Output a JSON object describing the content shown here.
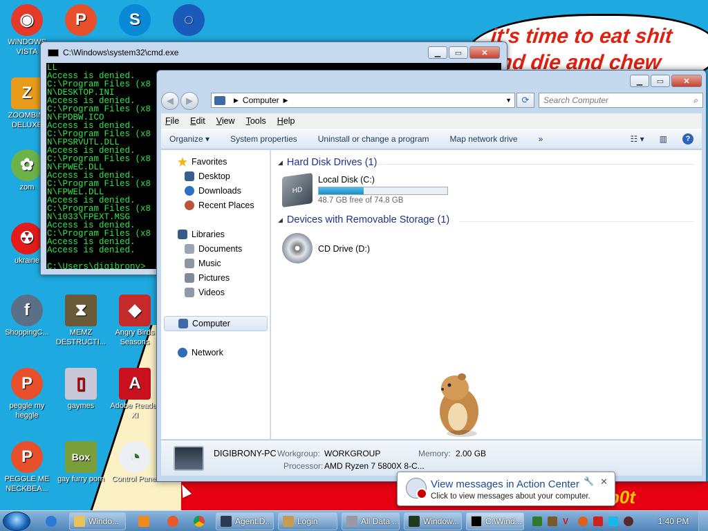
{
  "wallpaper": {
    "speech_text": "it's time to eat shit and die and chew",
    "red_text": "b0t"
  },
  "desktop_icons": [
    {
      "label": "WINDOWS VISTA",
      "color": "#e33a2a",
      "glyph": "◉"
    },
    {
      "label": "ZOOMBINI DELUXE",
      "color": "#e89a1a",
      "glyph": "Z"
    },
    {
      "label": "zom",
      "color": "#6cb24b",
      "glyph": "✿"
    },
    {
      "label": "ukraine",
      "color": "#e31b1b",
      "glyph": "☢"
    },
    {
      "label": "ShoppingC...",
      "color": "#5b6f86",
      "glyph": "f"
    },
    {
      "label": "peggle my heggle",
      "color": "#e7502a",
      "glyph": "P"
    },
    {
      "label": "PEGGLE ME NECKBEA...",
      "color": "#e7502a",
      "glyph": "P"
    },
    {
      "label": "",
      "color": "#e7502a",
      "glyph": "P"
    },
    {
      "label": "MEMZ DESTRUCTI...",
      "color": "#6a5a3a",
      "glyph": "⧗"
    },
    {
      "label": "gaymes",
      "color": "#c8c8d8",
      "glyph": "▯"
    },
    {
      "label": "gay furry porn",
      "color": "#7a9e3a",
      "glyph": "Box"
    },
    {
      "label": "",
      "color": "#0a8ad6",
      "glyph": "S"
    },
    {
      "label": "Angry Birds Seasons",
      "color": "#c42a2a",
      "glyph": "◆"
    },
    {
      "label": "Adobe Reader XI",
      "color": "#c8101e",
      "glyph": "A"
    },
    {
      "label": "Control Panel",
      "color": "#eceff3",
      "glyph": "◔"
    },
    {
      "label": "",
      "color": "#1a5ab8",
      "glyph": "◌"
    }
  ],
  "cmd": {
    "title": "C:\\Windows\\system32\\cmd.exe",
    "lines": [
      "LL",
      "Access is denied.",
      "C:\\Program Files (x8",
      "N\\DESKTOP.INI",
      "Access is denied.",
      "C:\\Program Files (x8",
      "N\\FPDBW.ICO",
      "Access is denied.",
      "C:\\Program Files (x8",
      "N\\FPSRVUTL.DLL",
      "Access is denied.",
      "C:\\Program Files (x8",
      "N\\FPWEC.DLL",
      "Access is denied.",
      "C:\\Program Files (x8",
      "N\\FPWEL.DLL",
      "Access is denied.",
      "C:\\Program Files (x8",
      "N\\1033\\FPEXT.MSG",
      "Access is denied.",
      "C:\\Program Files (x8",
      "Access is denied.",
      "Access is denied.",
      "",
      "C:\\Users\\digibrony>"
    ]
  },
  "explorer": {
    "address": "Computer",
    "search_placeholder": "Search Computer",
    "menu": [
      "File",
      "Edit",
      "View",
      "Tools",
      "Help"
    ],
    "commands": [
      "Organize ▾",
      "System properties",
      "Uninstall or change a program",
      "Map network drive",
      "»"
    ],
    "nav": {
      "favorites": "Favorites",
      "desktop": "Desktop",
      "downloads": "Downloads",
      "recent": "Recent Places",
      "libraries": "Libraries",
      "documents": "Documents",
      "music": "Music",
      "pictures": "Pictures",
      "videos": "Videos",
      "computer": "Computer",
      "network": "Network"
    },
    "groups": {
      "hdd": "Hard Disk Drives (1)",
      "removable": "Devices with Removable Storage (1)"
    },
    "local_disk": {
      "name": "Local Disk (C:)",
      "free_text": "48.7 GB free of 74.8 GB",
      "used_fraction": 0.35
    },
    "cd_drive": {
      "name": "CD Drive (D:)"
    },
    "details": {
      "pc_name": "DIGIBRONY-PC",
      "workgroup_label": "Workgroup:",
      "workgroup": "WORKGROUP",
      "memory_label": "Memory:",
      "memory": "2.00 GB",
      "processor_label": "Processor:",
      "processor": "AMD Ryzen 7 5800X 8-C..."
    }
  },
  "popup": {
    "title": "View messages in Action Center",
    "subtitle": "Click to view messages about your computer."
  },
  "taskbar": {
    "buttons": [
      "Windo...",
      "Agent.D...",
      "Login",
      "All Data ...",
      "Window...",
      "C:\\Wind..."
    ],
    "clock": "1:40 PM"
  }
}
